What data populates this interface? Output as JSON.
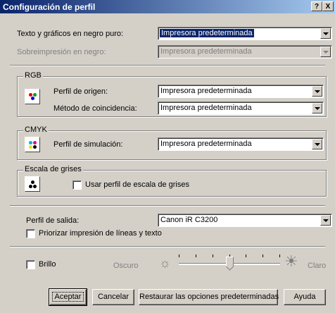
{
  "window": {
    "title": "Configuración de perfil",
    "help_label": "?",
    "close_label": "X"
  },
  "pure_black": {
    "label": "Texto y gráficos en negro puro:",
    "value": "Impresora predeterminada"
  },
  "overprint": {
    "label": "Sobreimpresión en negro:",
    "value": "Impresora predeterminada"
  },
  "rgb": {
    "legend": "RGB",
    "source_label": "Perfil de origen:",
    "source_value": "Impresora predeterminada",
    "matching_label": "Método de coincidencia:",
    "matching_value": "Impresora predeterminada"
  },
  "cmyk": {
    "legend": "CMYK",
    "simulation_label": "Perfil de simulación:",
    "simulation_value": "Impresora predeterminada"
  },
  "grayscale": {
    "legend": "Escala de grises",
    "use_profile_label": "Usar perfil de escala de grises",
    "use_profile_checked": false
  },
  "output": {
    "label": "Perfil de salida:",
    "value": "Canon iR C3200",
    "prioritize_label": "Priorizar impresión de líneas y texto",
    "prioritize_checked": false
  },
  "brightness": {
    "label": "Brillo",
    "checked": false,
    "dark_label": "Oscuro",
    "light_label": "Claro",
    "level": 0.5
  },
  "buttons": {
    "accept": "Aceptar",
    "cancel": "Cancelar",
    "restore": "Restaurar las opciones predeterminadas",
    "help": "Ayuda"
  },
  "icons": {
    "rgb": "rgb-color-icon",
    "cmyk": "cmyk-color-icon",
    "grayscale": "grayscale-icon",
    "dark": "dim-sun-icon",
    "light": "bright-sun-icon"
  },
  "colors": {
    "title_start": "#0a246a",
    "title_end": "#a6caf0",
    "selection": "#0a246a",
    "face": "#d4d0c8"
  }
}
